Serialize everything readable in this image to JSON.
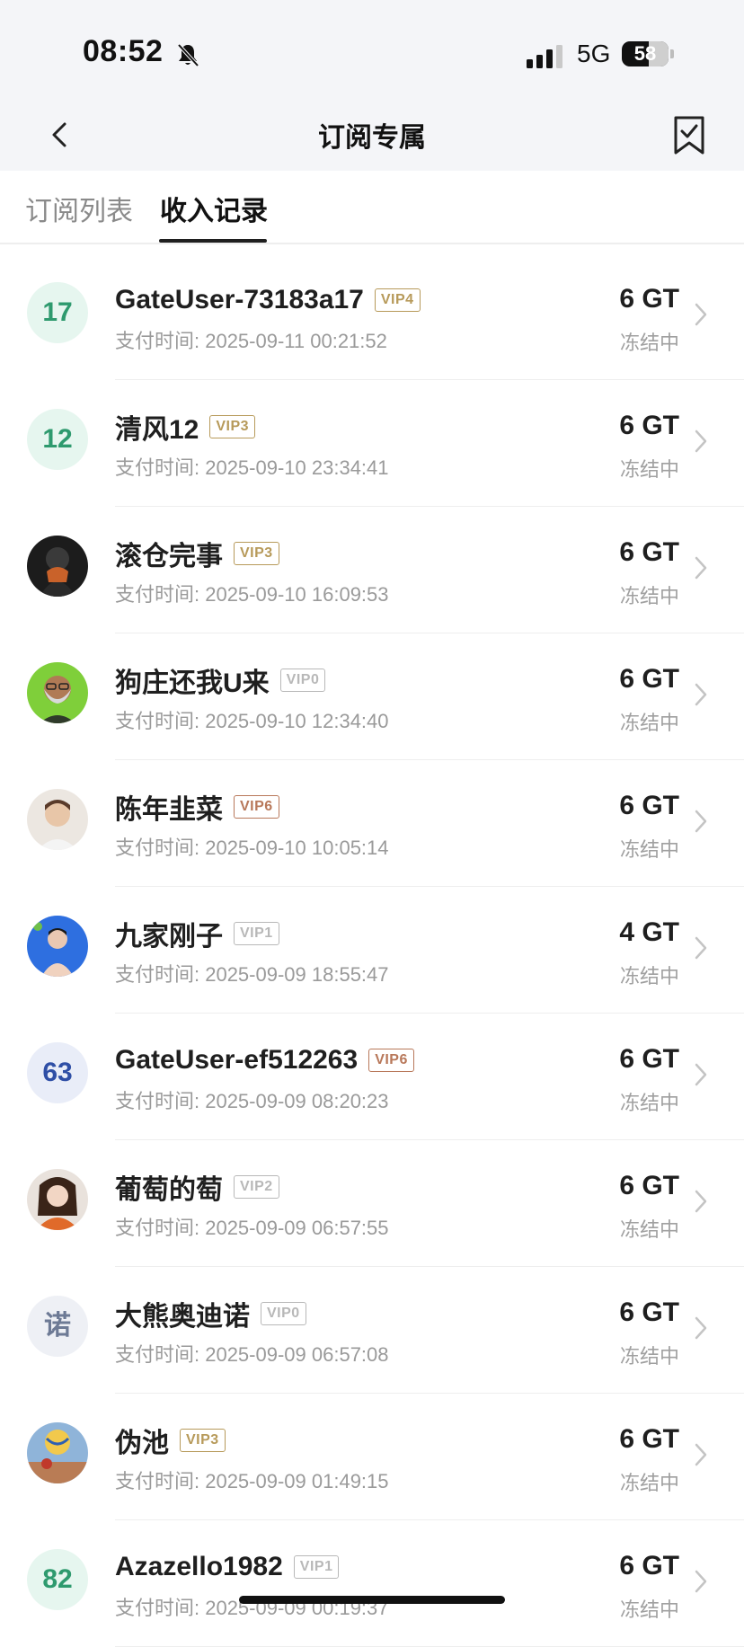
{
  "status_bar": {
    "time": "08:52",
    "network": "5G",
    "battery": "58",
    "battery_level": 0.58
  },
  "header": {
    "title": "订阅专属"
  },
  "tabs": [
    {
      "label": "订阅列表",
      "active": false
    },
    {
      "label": "收入记录",
      "active": true
    }
  ],
  "colors": {
    "vip_gold": "#b79a5a",
    "vip_gray": "#b8b8b8",
    "vip_brown": "#b8785a",
    "teal_text": "#2e9a6e",
    "teal_bg": "#e6f6ef",
    "blue_text": "#2f4fa6",
    "blue_bg": "#e9edf8",
    "gray_text": "#6d7a95",
    "gray_bg": "#eef0f5"
  },
  "records": [
    {
      "name": "GateUser-73183a17",
      "vip": "VIP4",
      "vip_color": "gold",
      "time": "支付时间: 2025-09-11 00:21:52",
      "amount": "6 GT",
      "status": "冻结中",
      "avatar": {
        "type": "text",
        "text": "17",
        "color": "teal"
      }
    },
    {
      "name": "清风12",
      "vip": "VIP3",
      "vip_color": "gold",
      "time": "支付时间: 2025-09-10 23:34:41",
      "amount": "6 GT",
      "status": "冻结中",
      "avatar": {
        "type": "text",
        "text": "12",
        "color": "teal"
      }
    },
    {
      "name": "滚仓完事",
      "vip": "VIP3",
      "vip_color": "gold",
      "time": "支付时间: 2025-09-10 16:09:53",
      "amount": "6 GT",
      "status": "冻结中",
      "avatar": {
        "type": "photo",
        "icon": "user-photo-dark"
      }
    },
    {
      "name": "狗庄还我U来",
      "vip": "VIP0",
      "vip_color": "gray",
      "time": "支付时间: 2025-09-10 12:34:40",
      "amount": "6 GT",
      "status": "冻结中",
      "avatar": {
        "type": "photo",
        "icon": "user-photo-green"
      }
    },
    {
      "name": "陈年韭菜",
      "vip": "VIP6",
      "vip_color": "brown",
      "time": "支付时间: 2025-09-10 10:05:14",
      "amount": "6 GT",
      "status": "冻结中",
      "avatar": {
        "type": "photo",
        "icon": "user-photo-light"
      }
    },
    {
      "name": "九家刚子",
      "vip": "VIP1",
      "vip_color": "gray",
      "time": "支付时间: 2025-09-09 18:55:47",
      "amount": "4 GT",
      "status": "冻结中",
      "avatar": {
        "type": "photo",
        "icon": "user-photo-blue"
      }
    },
    {
      "name": "GateUser-ef512263",
      "vip": "VIP6",
      "vip_color": "brown",
      "time": "支付时间: 2025-09-09 08:20:23",
      "amount": "6 GT",
      "status": "冻结中",
      "avatar": {
        "type": "text",
        "text": "63",
        "color": "blue"
      }
    },
    {
      "name": "葡萄的萄",
      "vip": "VIP2",
      "vip_color": "gray",
      "time": "支付时间: 2025-09-09 06:57:55",
      "amount": "6 GT",
      "status": "冻结中",
      "avatar": {
        "type": "photo",
        "icon": "user-photo-orange"
      }
    },
    {
      "name": "大熊奥迪诺",
      "vip": "VIP0",
      "vip_color": "gray",
      "time": "支付时间: 2025-09-09 06:57:08",
      "amount": "6 GT",
      "status": "冻结中",
      "avatar": {
        "type": "text",
        "text": "诺",
        "color": "gray"
      }
    },
    {
      "name": "伪池",
      "vip": "VIP3",
      "vip_color": "gold",
      "time": "支付时间: 2025-09-09 01:49:15",
      "amount": "6 GT",
      "status": "冻结中",
      "avatar": {
        "type": "photo",
        "icon": "user-photo-sport"
      }
    },
    {
      "name": "Azazello1982",
      "vip": "VIP1",
      "vip_color": "gray",
      "time": "支付时间: 2025-09-09 00:19:37",
      "amount": "6 GT",
      "status": "冻结中",
      "avatar": {
        "type": "text",
        "text": "82",
        "color": "teal"
      }
    }
  ]
}
